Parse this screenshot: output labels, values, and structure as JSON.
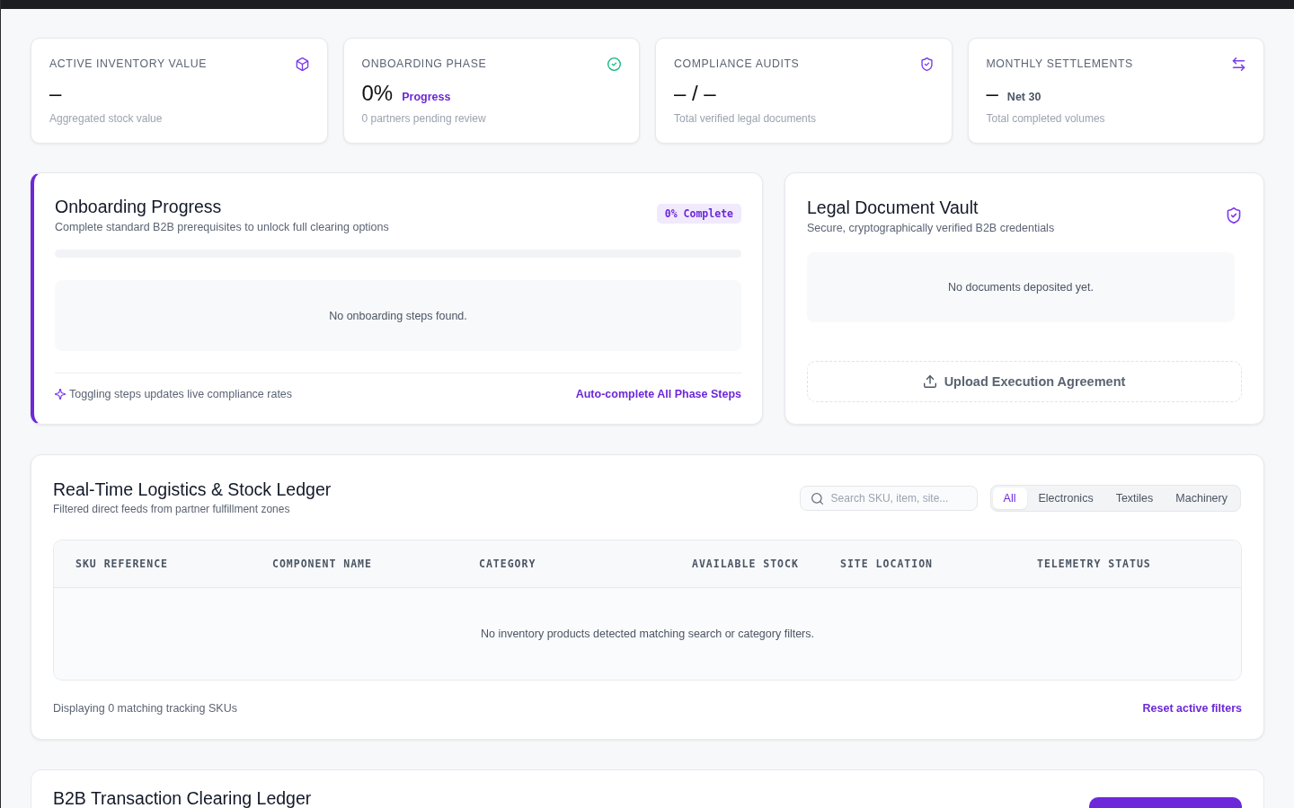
{
  "stat_cards": [
    {
      "label": "ACTIVE INVENTORY VALUE",
      "value": "–",
      "caption": "Aggregated stock value"
    },
    {
      "label": "ONBOARDING PHASE",
      "value": "0%",
      "suffix": {
        "text": "Progress",
        "kind": "accent"
      },
      "caption": "0 partners pending review"
    },
    {
      "label": "COMPLIANCE AUDITS",
      "value": "– / –",
      "caption": "Total verified legal documents"
    },
    {
      "label": "MONTHLY SETTLEMENTS",
      "value": "–",
      "suffix": {
        "text": "Net 30",
        "kind": "plain"
      },
      "caption": "Total completed volumes"
    }
  ],
  "onboarding": {
    "title": "Onboarding Progress",
    "subtitle": "Complete standard B2B prerequisites to unlock full clearing options",
    "badge": "0% Complete",
    "level": 0,
    "empty_message": "No onboarding steps found.",
    "hint": "Toggling steps updates live compliance rates",
    "action": "Auto-complete All Phase Steps"
  },
  "document_vault": {
    "title": "Legal Document Vault",
    "subtitle": "Secure, cryptographically verified B2B credentials",
    "empty_message": "No documents deposited yet.",
    "upload_button": "Upload Execution Agreement"
  },
  "stock_ledger": {
    "title": "Real-Time Logistics & Stock Ledger",
    "subtitle": "Filtered direct feeds from partner fulfillment zones",
    "search": {
      "placeholder": "Search SKU, item, site..."
    },
    "filters": [
      {
        "label": "All",
        "selected": true
      },
      {
        "label": "Electronics",
        "selected": false
      },
      {
        "label": "Textiles",
        "selected": false
      },
      {
        "label": "Machinery",
        "selected": false
      }
    ],
    "table": {
      "columns": [
        "SKU REFERENCE",
        "COMPONENT NAME",
        "CATEGORY",
        "AVAILABLE STOCK",
        "SITE LOCATION",
        "TELEMETRY STATUS"
      ],
      "empty_message": "No inventory products detected matching search or category filters."
    },
    "footer_text": "Displaying 0 matching tracking SKUs",
    "reset_link": "Reset active filters"
  },
  "clearing_ledger": {
    "title": "B2B Transaction Clearing Ledger"
  }
}
